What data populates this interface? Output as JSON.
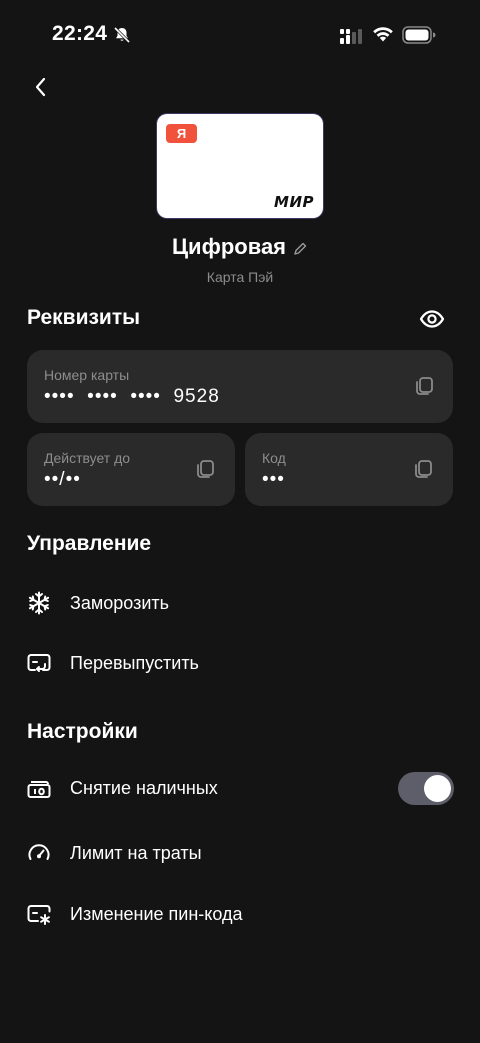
{
  "status_bar": {
    "time": "22:24"
  },
  "card": {
    "ya_logo": "Я",
    "payment_system": "МИР",
    "name": "Цифровая",
    "subtitle": "Карта Пэй"
  },
  "details": {
    "title": "Реквизиты",
    "card_number": {
      "label": "Номер карты",
      "value": "••••  ••••  ••••  9528"
    },
    "expiry": {
      "label": "Действует до",
      "value": "••/••"
    },
    "code": {
      "label": "Код",
      "value": "•••"
    }
  },
  "management": {
    "title": "Управление",
    "items": [
      {
        "label": "Заморозить",
        "icon": "snowflake-icon"
      },
      {
        "label": "Перевыпустить",
        "icon": "reissue-card-icon"
      }
    ]
  },
  "settings": {
    "title": "Настройки",
    "items": [
      {
        "label": "Снятие наличных",
        "icon": "cash-withdrawal-icon",
        "toggle_on": true
      },
      {
        "label": "Лимит на траты",
        "icon": "speedometer-icon"
      },
      {
        "label": "Изменение пин-кода",
        "icon": "pin-code-icon"
      }
    ]
  },
  "colors": {
    "background": "#141414",
    "field_bg": "#2a2a2a",
    "ya_red": "#f0523b",
    "toggle_on": "#5d5e6a"
  }
}
